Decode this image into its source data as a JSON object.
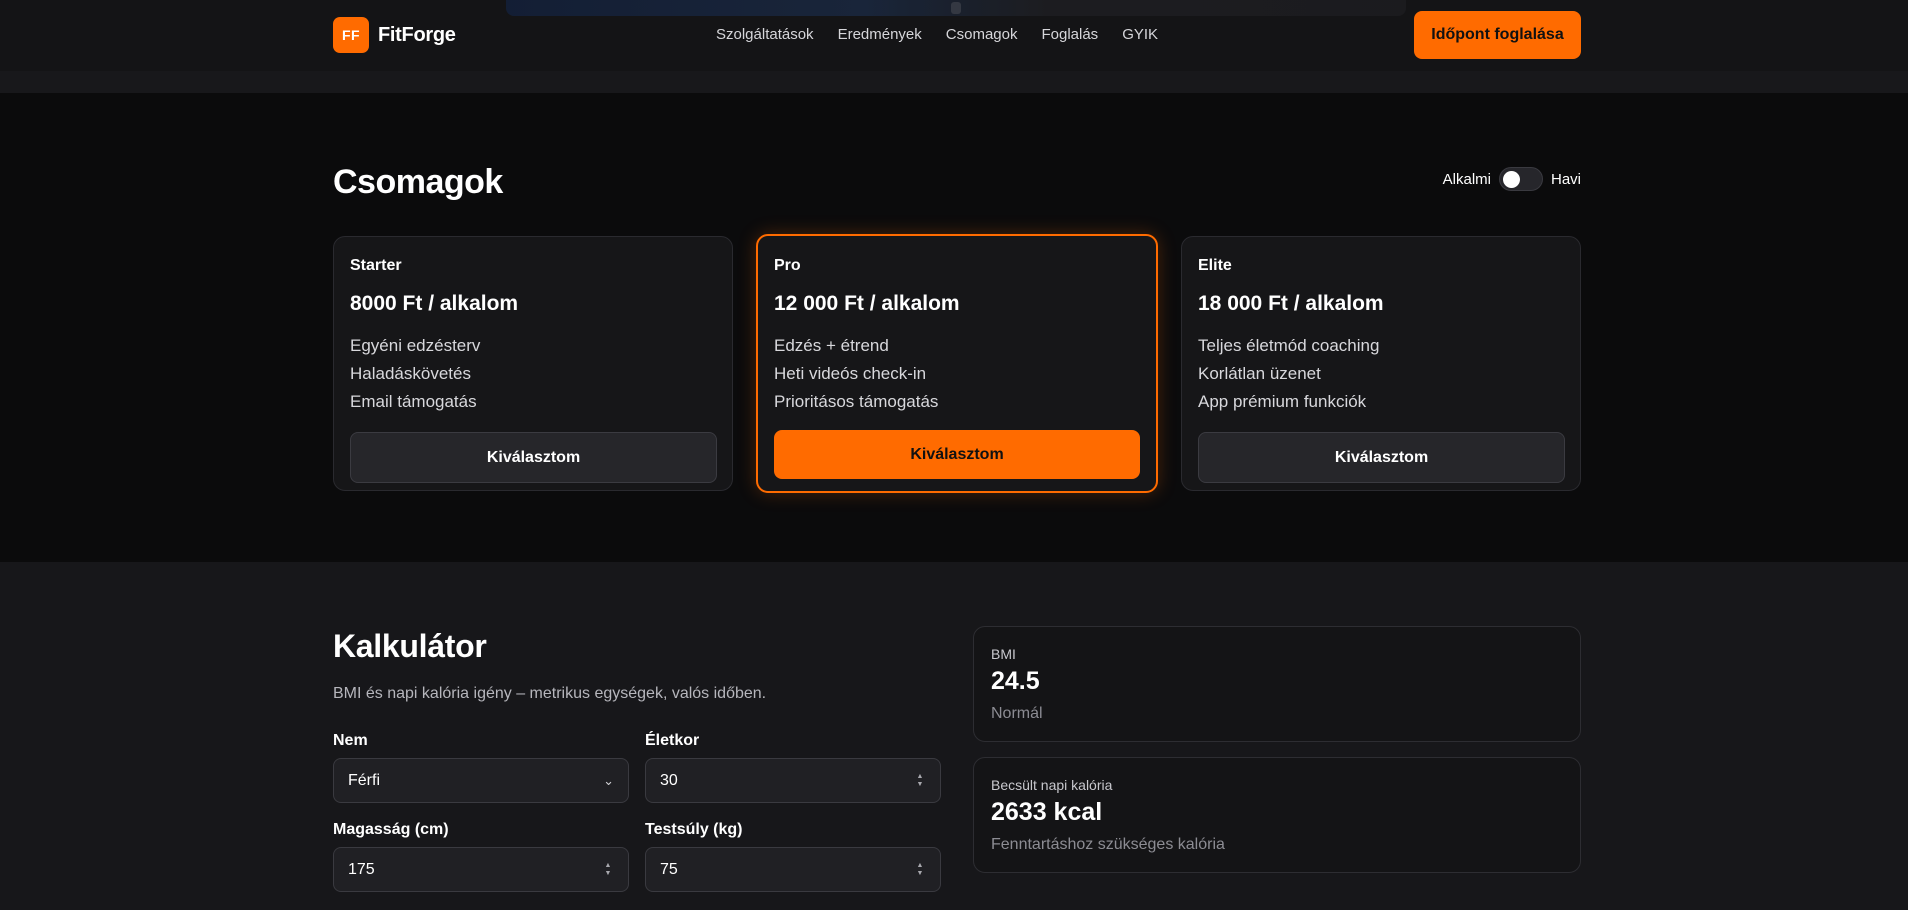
{
  "header": {
    "logo_text": "FF",
    "brand": "FitForge",
    "nav": [
      "Szolgáltatások",
      "Eredmények",
      "Csomagok",
      "Foglalás",
      "GYIK"
    ],
    "cta": "Időpont foglalása"
  },
  "packages": {
    "title": "Csomagok",
    "toggle_left": "Alkalmi",
    "toggle_right": "Havi",
    "toggle_state": "Alkalmi",
    "cards": [
      {
        "name": "Starter",
        "price": "8000 Ft / alkalom",
        "features": [
          "Egyéni edzésterv",
          "Haladáskövetés",
          "Email támogatás"
        ],
        "button": "Kiválasztom",
        "featured": false
      },
      {
        "name": "Pro",
        "price": "12 000 Ft / alkalom",
        "features": [
          "Edzés + étrend",
          "Heti videós check-in",
          "Prioritásos támogatás"
        ],
        "button": "Kiválasztom",
        "featured": true
      },
      {
        "name": "Elite",
        "price": "18 000 Ft / alkalom",
        "features": [
          "Teljes életmód coaching",
          "Korlátlan üzenet",
          "App prémium funkciók"
        ],
        "button": "Kiválasztom",
        "featured": false
      }
    ]
  },
  "calculator": {
    "title": "Kalkulátor",
    "subtitle": "BMI és napi kalória igény – metrikus egységek, valós időben.",
    "fields": {
      "sex": {
        "label": "Nem",
        "value": "Férfi"
      },
      "age": {
        "label": "Életkor",
        "value": "30"
      },
      "height": {
        "label": "Magasság (cm)",
        "value": "175"
      },
      "weight": {
        "label": "Testsúly (kg)",
        "value": "75"
      }
    },
    "bmi": {
      "label": "BMI",
      "value": "24.5",
      "note": "Normál"
    },
    "calories": {
      "label": "Becsült napi kalória",
      "value": "2633 kcal",
      "note": "Fenntartáshoz szükséges kalória"
    }
  },
  "colors": {
    "accent": "#ff6b00",
    "background": "#0b0b0c",
    "surface": "#161618"
  }
}
